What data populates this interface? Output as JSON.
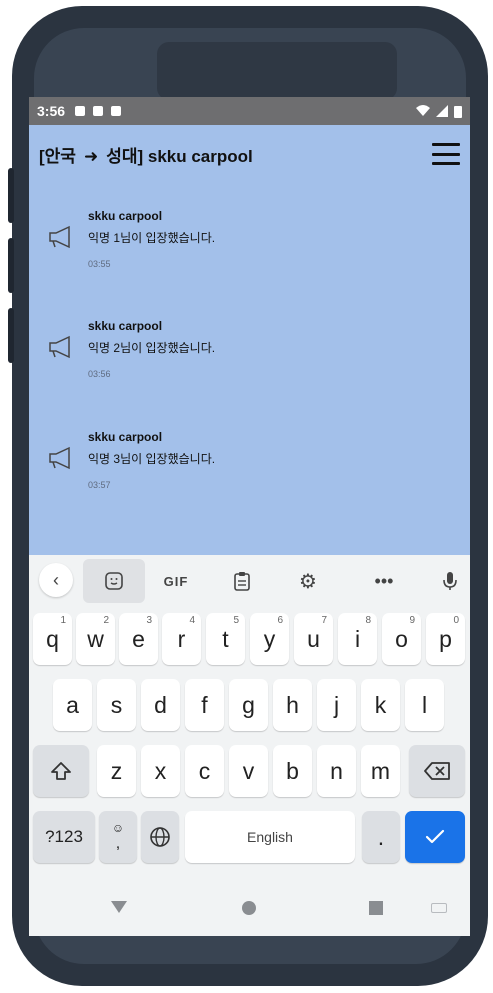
{
  "status_bar": {
    "time": "3:56"
  },
  "header": {
    "title_part1": "[안국",
    "arrow": "➜",
    "title_part2": "성대] skku carpool"
  },
  "messages": [
    {
      "sender": "skku carpool",
      "text": "익명 1님이 입장했습니다.",
      "time": "03:55"
    },
    {
      "sender": "skku carpool",
      "text": "익명 2님이 입장했습니다.",
      "time": "03:56"
    },
    {
      "sender": "skku carpool",
      "text": "익명 3님이 입장했습니다.",
      "time": "03:57"
    }
  ],
  "keyboard": {
    "toolbar": {
      "back": "‹",
      "gif": "GIF",
      "more": "•••"
    },
    "row1": [
      {
        "label": "q",
        "hint": "1"
      },
      {
        "label": "w",
        "hint": "2"
      },
      {
        "label": "e",
        "hint": "3"
      },
      {
        "label": "r",
        "hint": "4"
      },
      {
        "label": "t",
        "hint": "5"
      },
      {
        "label": "y",
        "hint": "6"
      },
      {
        "label": "u",
        "hint": "7"
      },
      {
        "label": "i",
        "hint": "8"
      },
      {
        "label": "o",
        "hint": "9"
      },
      {
        "label": "p",
        "hint": "0"
      }
    ],
    "row2": [
      "a",
      "s",
      "d",
      "f",
      "g",
      "h",
      "j",
      "k",
      "l"
    ],
    "row3": [
      "z",
      "x",
      "c",
      "v",
      "b",
      "n",
      "m"
    ],
    "symbols": "?123",
    "emoji_comma": ",",
    "space": "English",
    "period": "."
  },
  "colors": {
    "chat_background": "#a3c0ea",
    "accent": "#1a73e8"
  }
}
